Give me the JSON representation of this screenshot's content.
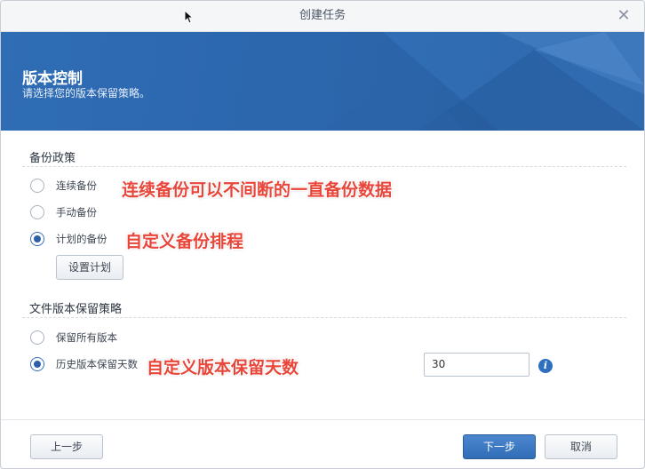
{
  "window": {
    "title": "创建任务",
    "close_icon": "close-icon"
  },
  "header": {
    "title": "版本控制",
    "subtitle": "请选择您的版本保留策略。"
  },
  "backup_policy": {
    "section_title": "备份政策",
    "options": [
      {
        "label": "连续备份",
        "checked": false
      },
      {
        "label": "手动备份",
        "checked": false
      },
      {
        "label": "计划的备份",
        "checked": true
      }
    ],
    "schedule_button": "设置计划"
  },
  "retention_policy": {
    "section_title": "文件版本保留策略",
    "options": [
      {
        "label": "保留所有版本",
        "checked": false
      },
      {
        "label": "历史版本保留天数",
        "checked": true
      }
    ],
    "days_value": "30",
    "info_icon": "info-icon"
  },
  "annotations": {
    "continuous": "连续备份可以不间断的一直备份数据",
    "scheduled": "自定义备份排程",
    "retention": "自定义版本保留天数"
  },
  "footer": {
    "back": "上一步",
    "next": "下一步",
    "cancel": "取消"
  },
  "colors": {
    "banner": "#2c67ae",
    "primary_button": "#3a74bf",
    "annotation": "#e8463a"
  }
}
